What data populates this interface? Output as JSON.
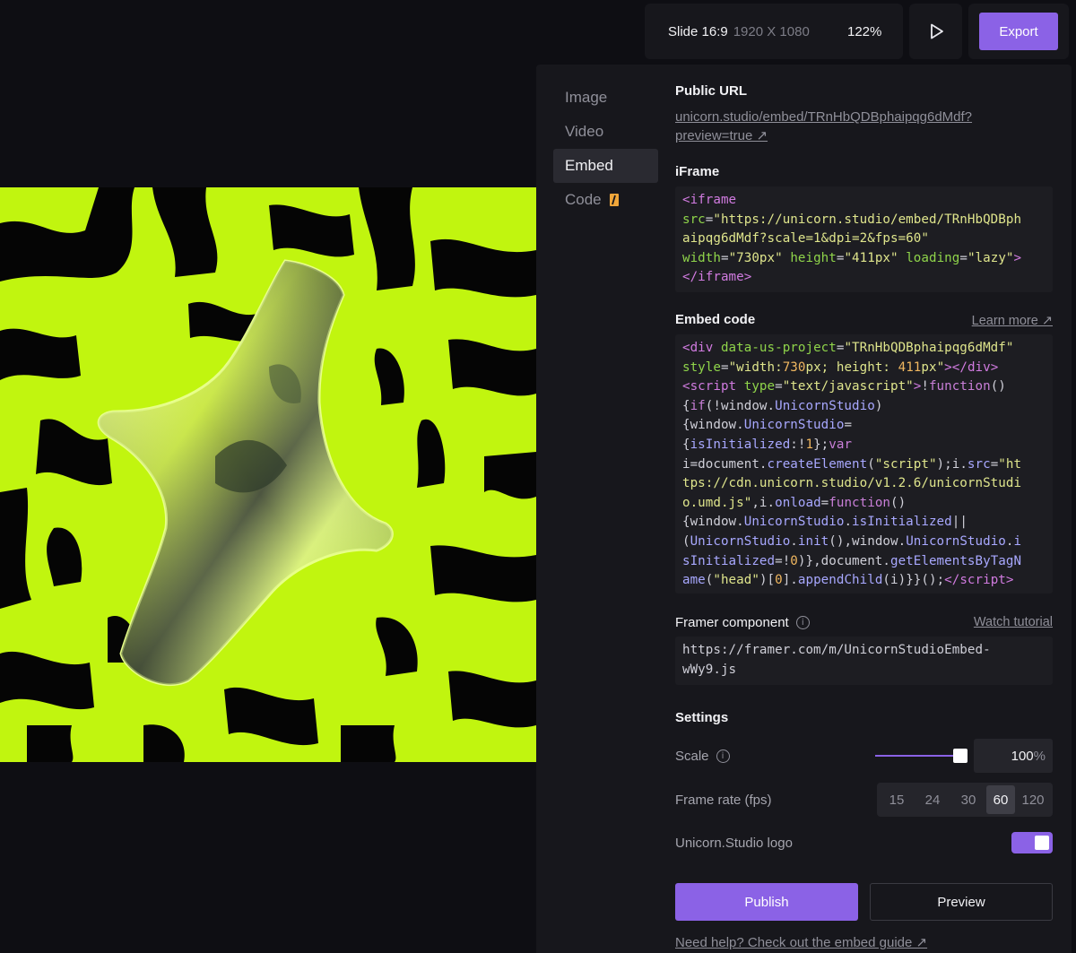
{
  "toolbar": {
    "format_label": "Slide 16:9",
    "resolution": "1920 X 1080",
    "zoom": "122%",
    "export_label": "Export"
  },
  "nav": {
    "items": [
      {
        "label": "Image"
      },
      {
        "label": "Video"
      },
      {
        "label": "Embed"
      },
      {
        "label": "Code"
      }
    ],
    "active": "Embed"
  },
  "public_url": {
    "title": "Public URL",
    "line1": "unicorn.studio/embed/TRnHbQDBphaipqg6dMdf?",
    "line2": "preview=true ↗"
  },
  "iframe": {
    "title": "iFrame"
  },
  "embed_code": {
    "title": "Embed code",
    "learn_more": "Learn more ↗"
  },
  "framer": {
    "title": "Framer component",
    "watch": "Watch tutorial",
    "url_line1": "https://framer.com/m/UnicornStudioEmbed-",
    "url_line2": "wWy9.js"
  },
  "settings": {
    "title": "Settings",
    "scale_label": "Scale",
    "scale_value": "100",
    "scale_unit": "%",
    "scale_fraction": 1.0,
    "fps_label": "Frame rate (fps)",
    "fps_options": [
      "15",
      "24",
      "30",
      "60",
      "120"
    ],
    "fps_selected": "60",
    "logo_label": "Unicorn.Studio logo",
    "logo_enabled": true
  },
  "actions": {
    "publish": "Publish",
    "preview": "Preview",
    "help": "Need help? Check out the embed guide ↗"
  },
  "colors": {
    "accent": "#8b62e6",
    "art_green": "#c1f50f"
  }
}
